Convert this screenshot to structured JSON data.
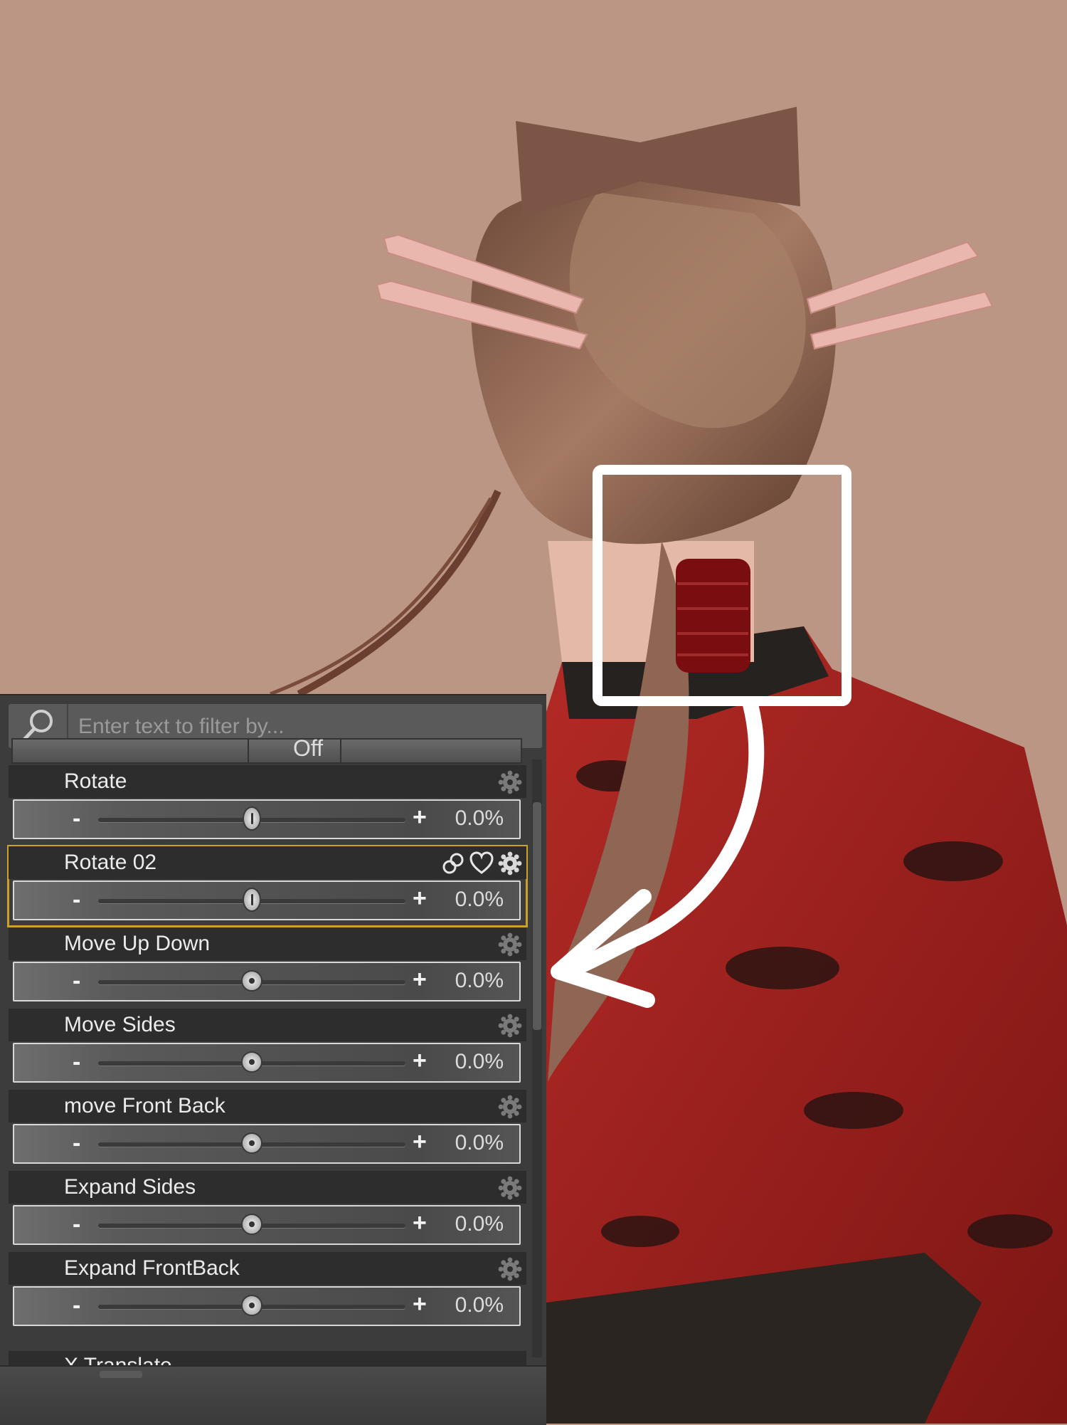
{
  "filter": {
    "placeholder": "Enter text to filter by..."
  },
  "previous_row_label": "Off",
  "parameters": [
    {
      "label": "Rotate",
      "value": "0.0%",
      "level": 0.5,
      "thumb": "oval",
      "selected": false
    },
    {
      "label": "Rotate 02",
      "value": "0.0%",
      "level": 0.5,
      "thumb": "oval",
      "selected": true
    },
    {
      "label": "Move Up Down",
      "value": "0.0%",
      "level": 0.5,
      "thumb": "dot",
      "selected": false
    },
    {
      "label": "Move Sides",
      "value": "0.0%",
      "level": 0.5,
      "thumb": "dot",
      "selected": false
    },
    {
      "label": "move Front Back",
      "value": "0.0%",
      "level": 0.5,
      "thumb": "dot",
      "selected": false
    },
    {
      "label": "Expand Sides",
      "value": "0.0%",
      "level": 0.5,
      "thumb": "dot",
      "selected": false
    },
    {
      "label": "Expand FrontBack",
      "value": "0.0%",
      "level": 0.5,
      "thumb": "dot",
      "selected": false
    }
  ],
  "partial_row_label": "X Translate",
  "slider_symbols": {
    "minus": "-",
    "plus": "+"
  },
  "colors": {
    "background": "#bc9684",
    "highlight_box": "#ffffff",
    "selection_outline": "#c9a227",
    "jacket_red": "#c0302a"
  },
  "icons": [
    "search-icon",
    "gear-icon",
    "link-icon",
    "heart-icon"
  ]
}
